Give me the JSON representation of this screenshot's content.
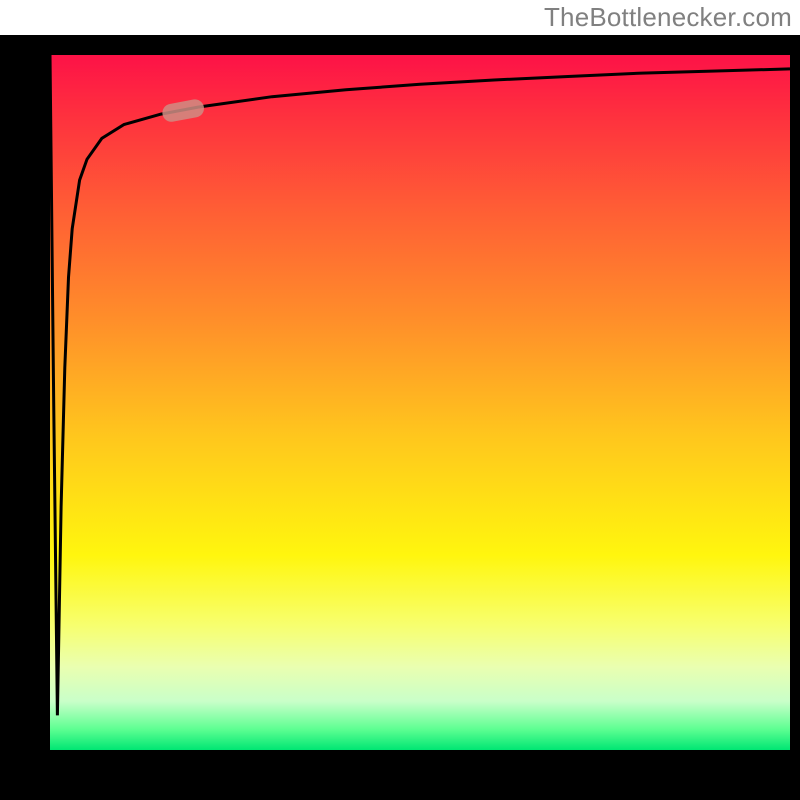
{
  "watermark": "TheBottlenecker.com",
  "chart_data": {
    "type": "line",
    "title": "",
    "xlabel": "",
    "ylabel": "",
    "xlim": [
      0,
      100
    ],
    "ylim": [
      0,
      100
    ],
    "grid": false,
    "legend": false,
    "annotations": [],
    "series": [
      {
        "name": "curve",
        "x": [
          0,
          0.5,
          1,
          1.5,
          2,
          2.5,
          3,
          4,
          5,
          7,
          10,
          15,
          20,
          30,
          40,
          50,
          60,
          70,
          80,
          90,
          100
        ],
        "y": [
          100,
          50,
          5,
          35,
          55,
          68,
          75,
          82,
          85,
          88,
          90,
          91.5,
          92.5,
          94,
          95,
          95.8,
          96.4,
          96.9,
          97.4,
          97.7,
          98
        ]
      }
    ],
    "marker": {
      "x": 18,
      "y": 92,
      "shape": "pill",
      "color": "#cf8d84"
    },
    "background_gradient": [
      "#fd1247",
      "#ff8e2a",
      "#fff60e",
      "#00e673"
    ]
  }
}
